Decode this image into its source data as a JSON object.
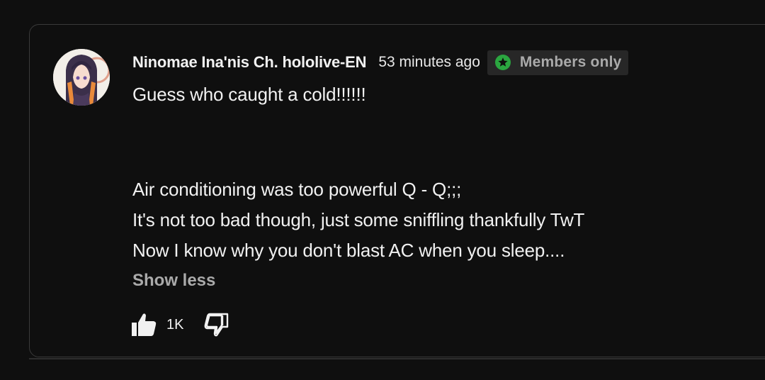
{
  "comment": {
    "author": "Ninomae Ina'nis Ch. hololive-EN",
    "timestamp": "53 minutes ago",
    "badge": {
      "label": "Members only",
      "icon": "star-icon",
      "icon_color": "#2ba640"
    },
    "lines": [
      "Guess who caught a cold!!!!!!",
      "",
      "",
      "Air conditioning was too powerful Q - Q;;;",
      "It's not too bad though, just some sniffling thankfully TwT",
      "Now I know why you don't blast AC when you sleep...."
    ],
    "show_less_label": "Show less",
    "like_count": "1K",
    "like_icon": "thumbs-up-icon",
    "dislike_icon": "thumbs-down-icon"
  },
  "colors": {
    "background": "#0f0f0f",
    "text_primary": "#f1f1f1",
    "text_secondary": "#aaaaaa",
    "badge_background": "#272727",
    "card_border": "#3a3a3a"
  }
}
